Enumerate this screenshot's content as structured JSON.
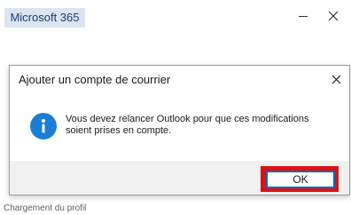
{
  "app": {
    "badge": "Microsoft 365",
    "status": "Chargement du profil"
  },
  "dialog": {
    "title": "Ajouter un compte de courrier",
    "message": "Vous devez relancer Outlook pour que ces modifications soient prises en compte.",
    "ok_label": "OK"
  },
  "icons": {
    "minimize": "minimize-icon",
    "close": "close-icon",
    "info": "info-icon"
  },
  "colors": {
    "accent": "#1a7fd4",
    "highlight": "#e01010",
    "badge_bg": "#dbe4f2"
  }
}
